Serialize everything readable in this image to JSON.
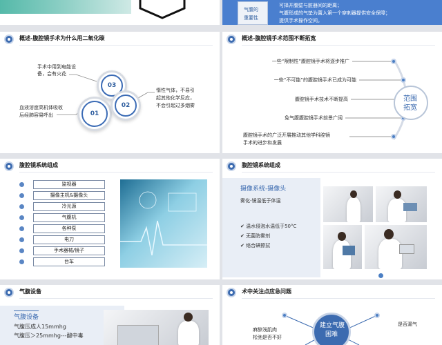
{
  "top_left": {},
  "top_right": {
    "badge": [
      "气腹的",
      "重要性"
    ],
    "bullets": [
      "可择开腹壁与脏器间的距离；",
      "气腹形成的气垫为置入第一个穿刺器提供安全保障；",
      "提供手术操作空间。"
    ]
  },
  "p1": {
    "title": "概述-腹腔镜手术为什么用二氧化碳",
    "t_left1": [
      "手术中用到电能设",
      "备，会有火花"
    ],
    "t_left2": [
      "血液溶度高机体吸收",
      "后经肺容易呼出"
    ],
    "t_right": [
      "惰性气体，不易引",
      "起其他化学反应，",
      "不会引起过多烟雾"
    ],
    "n1": "01",
    "n2": "02",
    "n3": "03"
  },
  "p2": {
    "title": "概述-腹腔镜手术范围不断拓宽",
    "items": [
      "一些“限制性”腹腔镜手术将逐步推广",
      "一些“不可能”的腹腔镜手术已成为可能",
      "腹腔镜手术技术不断提高",
      "免气腹腹腔镜手术前景广阔",
      "腹腔镜手术的广泛开展推动其他学科腔镜",
      "手术的进步和发展"
    ],
    "circle": [
      "范围",
      "拓宽"
    ]
  },
  "p3": {
    "title": "腹腔镜系统组成",
    "items": [
      "监视器",
      "摄像主机&摄像头",
      "冷光源",
      "气腹机",
      "各种泵",
      "电刀",
      "手术器械/镜子",
      "台车"
    ]
  },
  "p4": {
    "title": "腹腔镜系统组成",
    "heading": "摄像系统-摄像头",
    "sub": "雾化-镜温低于体温",
    "checks": [
      "温水侵泡水温低于50°C",
      "无菌防雾剂",
      "络合碘擦拭"
    ]
  },
  "p5": {
    "title": "气腹设备",
    "heading": "气腹设备",
    "lines": [
      "气腹压成人15mmhg",
      "气腹压＞25mmhg---酸中毒"
    ]
  },
  "p6": {
    "title": "术中关注点应急问题",
    "center": [
      "建立气腹",
      "困难"
    ],
    "left": [
      "麻醉浅肌肉",
      "松弛是否不好"
    ],
    "right": "是否漏气"
  },
  "colors": {
    "accent": "#3c6bb0",
    "band": "#4a7fcf",
    "light": "#e9eef6"
  }
}
